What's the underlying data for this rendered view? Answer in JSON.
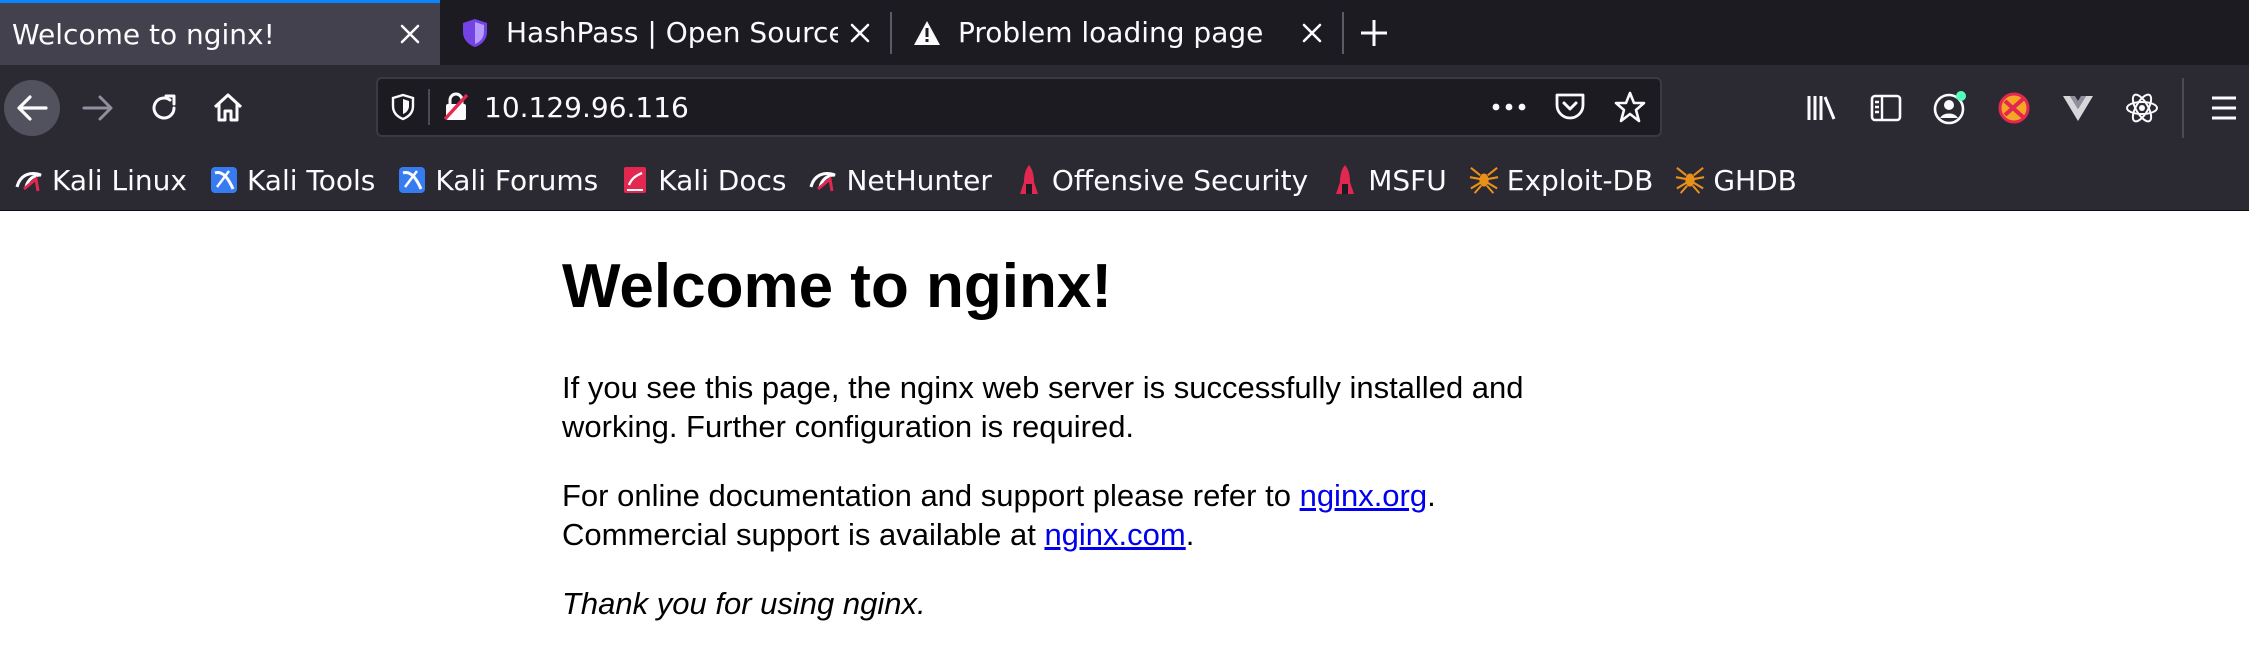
{
  "browser": {
    "tabs": [
      {
        "title": "Welcome to nginx!",
        "active": true,
        "icon": "none"
      },
      {
        "title": "HashPass | Open Source",
        "active": false,
        "icon": "shield-icon"
      },
      {
        "title": "Problem loading page",
        "active": false,
        "icon": "warning-icon"
      }
    ],
    "url": "10.129.96.116",
    "colors": {
      "accent": "#0a84ff",
      "tabstrip": "#1c1b22",
      "toolbar": "#2b2a33"
    }
  },
  "bookmarks": [
    {
      "label": "Kali Linux",
      "icon": "kali-dragon-icon"
    },
    {
      "label": "Kali Tools",
      "icon": "kali-tools-icon"
    },
    {
      "label": "Kali Forums",
      "icon": "kali-forums-icon"
    },
    {
      "label": "Kali Docs",
      "icon": "kali-docs-icon"
    },
    {
      "label": "NetHunter",
      "icon": "nethunter-icon"
    },
    {
      "label": "Offensive Security",
      "icon": "offsec-icon"
    },
    {
      "label": "MSFU",
      "icon": "msfu-icon"
    },
    {
      "label": "Exploit-DB",
      "icon": "exploitdb-spider-icon"
    },
    {
      "label": "GHDB",
      "icon": "ghdb-spider-icon"
    }
  ],
  "page": {
    "heading": "Welcome to nginx!",
    "para1": "If you see this page, the nginx web server is successfully installed and working. Further configuration is required.",
    "para2_prefix": "For online documentation and support please refer to ",
    "para2_link": "nginx.org",
    "para2_suffix": ".",
    "para3_prefix": "Commercial support is available at ",
    "para3_link": "nginx.com",
    "para3_suffix": ".",
    "thanks": "Thank you for using nginx."
  }
}
